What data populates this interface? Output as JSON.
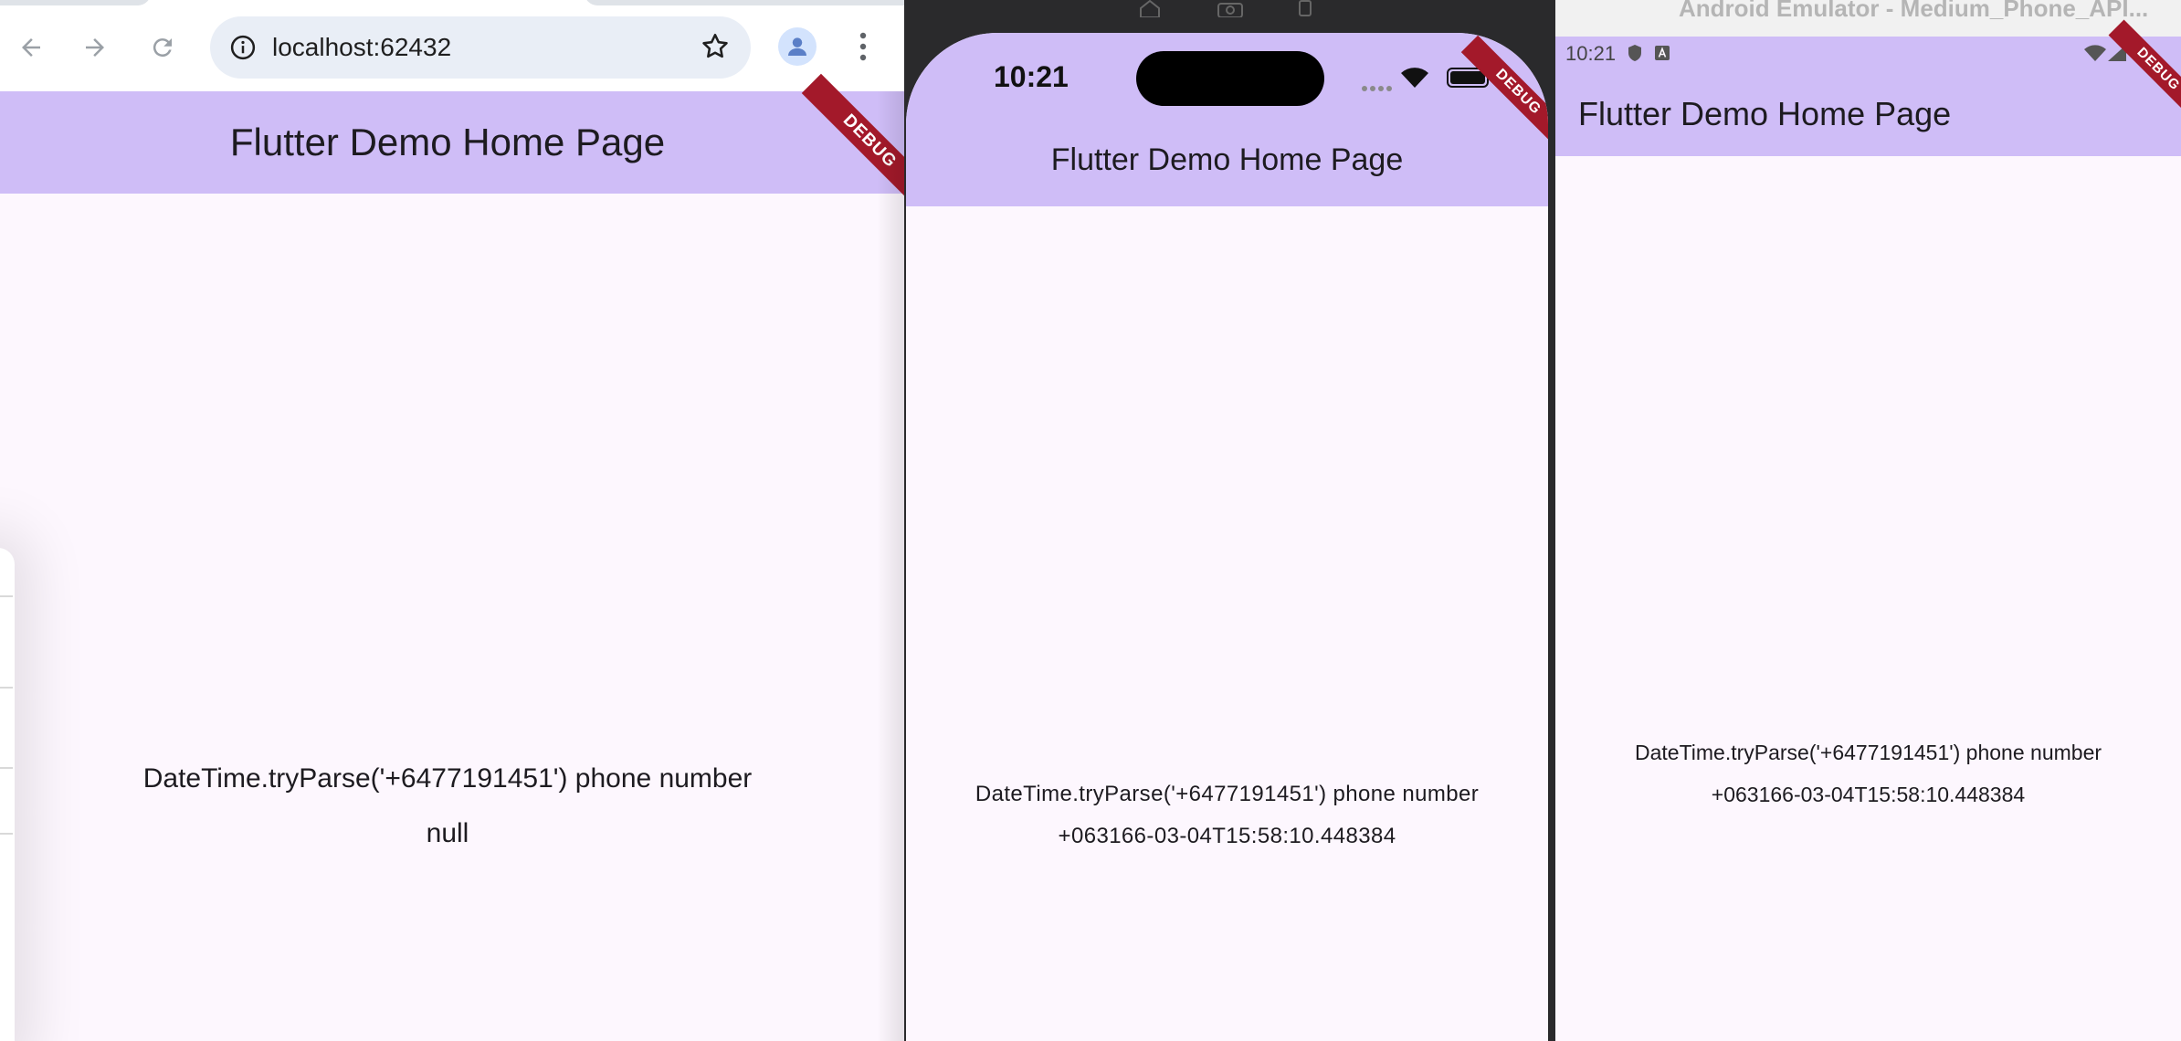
{
  "browser": {
    "url": "localhost:62432",
    "icons": [
      "back-arrow-icon",
      "forward-arrow-icon",
      "reload-icon",
      "site-info-icon",
      "bookmark-star-icon",
      "profile-avatar-icon",
      "more-menu-icon"
    ],
    "app": {
      "title": "Flutter Demo Home Page",
      "debug": "DEBUG",
      "label": "DateTime.tryParse('+6477191451') phone number",
      "result": "null"
    }
  },
  "ios_simulator": {
    "status_time": "10:21",
    "app": {
      "title": "Flutter Demo Home Page",
      "debug": "DEBUG",
      "label": "DateTime.tryParse('+6477191451') phone number",
      "result": "+063166-03-04T15:58:10.448384"
    }
  },
  "android_emulator": {
    "window_title": "Android Emulator - Medium_Phone_API...",
    "status_time": "10:21",
    "app": {
      "title": "Flutter Demo Home Page",
      "debug": "DEBUG",
      "label": "DateTime.tryParse('+6477191451') phone number",
      "result": "+063166-03-04T15:58:10.448384"
    }
  },
  "colors": {
    "appbar": "#cfbdf7",
    "page_background": "#fdf7fe",
    "debug_banner": "#a3192a",
    "omnibox": "#e9eef6"
  }
}
